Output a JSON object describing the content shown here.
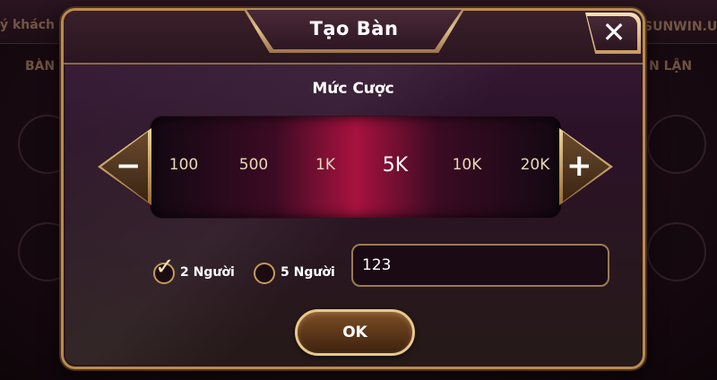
{
  "background": {
    "left_text": "ý khách",
    "left_text2": "BÀN",
    "right_text": "SUNWIN.U",
    "right_text2": "N LẬN"
  },
  "dialog": {
    "title": "Tạo Bàn",
    "close_glyph": "✕",
    "bet_section_label": "Mức Cược",
    "bet_options": [
      "100",
      "500",
      "1K",
      "5K",
      "10K",
      "20K"
    ],
    "selected_bet": "5K",
    "decrease_glyph": "−",
    "increase_glyph": "+",
    "player_options": [
      {
        "label": "2 Người",
        "checked": true
      },
      {
        "label": "5 Người",
        "checked": false
      }
    ],
    "table_name_value": "123",
    "ok_label": "OK"
  },
  "colors": {
    "accent_gold": "#c79a5b",
    "selector_center": "#a8123f"
  }
}
